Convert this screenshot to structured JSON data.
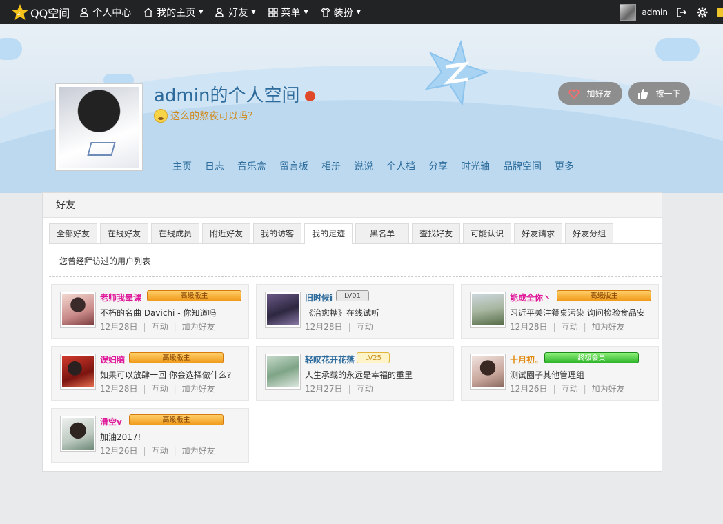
{
  "topbar": {
    "logo_text": "QQ空间",
    "nav": [
      {
        "label": "个人中心",
        "icon": "person-icon",
        "caret": false
      },
      {
        "label": "我的主页",
        "icon": "home-icon",
        "caret": true
      },
      {
        "label": "好友",
        "icon": "friends-icon",
        "caret": true
      },
      {
        "label": "菜单",
        "icon": "grid-icon",
        "caret": true
      },
      {
        "label": "装扮",
        "icon": "shirt-icon",
        "caret": true
      }
    ],
    "username": "admin"
  },
  "profile": {
    "title": "admin的个人空间",
    "signature": "这么的熬夜可以吗？",
    "add_friend_label": "加好友",
    "poke_label": "撩一下"
  },
  "subnav": [
    "主页",
    "日志",
    "音乐盒",
    "留言板",
    "相册",
    "说说",
    "个人档",
    "分享",
    "时光轴",
    "品牌空间",
    "更多"
  ],
  "panel": {
    "heading": "好友",
    "tabs": [
      "全部好友",
      "在线好友",
      "在线成员",
      "附近好友",
      "我的访客",
      "我的足迹",
      "黑名单",
      "查找好友",
      "可能认识",
      "好友请求",
      "好友分组"
    ],
    "active_tab": 5,
    "note": "您曾经拜访过的用户列表"
  },
  "cards": [
    {
      "name": "老师我晕课",
      "name_color": "#e0189a",
      "badge": "高级版主",
      "badge_type": "vip",
      "status": "不朽的名曲 Davichi - 你知道吗",
      "date": "12月28日",
      "actions": [
        "互动",
        "加为好友"
      ]
    },
    {
      "name": "旧时候i",
      "name_color": "#2d6b9c",
      "badge": "LV01",
      "badge_type": "lv",
      "status": "《治愈糖》在线试听",
      "date": "12月28日",
      "actions": [
        "互动"
      ]
    },
    {
      "name": "能成全你丶",
      "name_color": "#e0189a",
      "badge": "高级版主",
      "badge_type": "vip",
      "status": "习近平关注餐桌污染 询问检验食品安",
      "date": "12月28日",
      "actions": [
        "互动",
        "加为好友"
      ]
    },
    {
      "name": "误妇脑",
      "name_color": "#e0189a",
      "badge": "高级版主",
      "badge_type": "vip",
      "status": "如果可以放肆一回 你会选择做什么?",
      "date": "12月28日",
      "actions": [
        "互动",
        "加为好友"
      ]
    },
    {
      "name": "轻叹花开花落",
      "name_color": "#2d6b9c",
      "badge": "LV25",
      "badge_type": "lvgold",
      "status": "人生承载的永远是幸福的重里",
      "date": "12月27日",
      "actions": [
        "互动"
      ]
    },
    {
      "name": "十月初。",
      "name_color": "#e08a10",
      "badge": "终极会员",
      "badge_type": "green",
      "status": "测试圈子其他管理组",
      "date": "12月26日",
      "actions": [
        "互动",
        "加为好友"
      ]
    },
    {
      "name": "滑空v",
      "name_color": "#e0189a",
      "badge": "高级版主",
      "badge_type": "vip",
      "status": "加油2017!",
      "date": "12月26日",
      "actions": [
        "互动",
        "加为好友"
      ]
    }
  ]
}
